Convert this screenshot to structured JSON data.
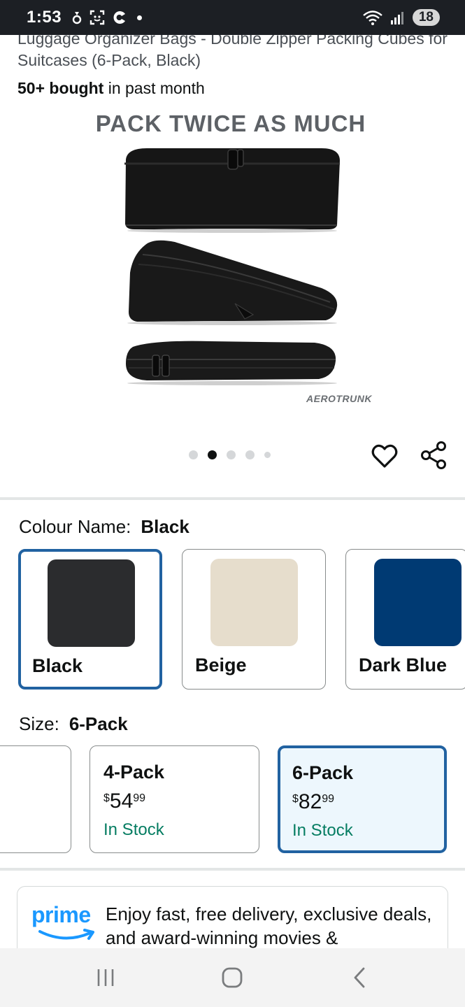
{
  "status_bar": {
    "time": "1:53",
    "battery": "18",
    "icons": [
      "notification-icon",
      "screenshot-icon",
      "app-icon",
      "wifi-icon",
      "signal-icon"
    ]
  },
  "product": {
    "title": "Luggage Organizer Bags - Double Zipper Packing Cubes for Suitcases (6-Pack, Black)",
    "bought_count": "50+ bought",
    "bought_suffix": "in past month",
    "image_headline": "PACK TWICE AS MUCH",
    "brand_logo": "AEROTRUNK",
    "carousel": {
      "total": 5,
      "active_index": 1
    }
  },
  "colour": {
    "label": "Colour Name:",
    "selected": "Black",
    "options": [
      {
        "name": "Black",
        "color": "#2b2c2e",
        "selected": true
      },
      {
        "name": "Beige",
        "color": "#e6ddcc",
        "selected": false
      },
      {
        "name": "Dark Blue",
        "color": "#003a73",
        "selected": false
      }
    ]
  },
  "size": {
    "label": "Size:",
    "selected": "6-Pack",
    "options": [
      {
        "name": "4-Pack",
        "currency": "$",
        "price_whole": "54",
        "price_fraction": "99",
        "stock": "In Stock",
        "selected": false
      },
      {
        "name": "6-Pack",
        "currency": "$",
        "price_whole": "82",
        "price_fraction": "99",
        "stock": "In Stock",
        "selected": true
      }
    ]
  },
  "prime": {
    "logo_text": "prime",
    "text": "Enjoy fast, free delivery, exclusive deals, and award-winning movies &"
  },
  "nav": {
    "icons": [
      "recent-apps-icon",
      "home-icon",
      "back-icon"
    ]
  }
}
